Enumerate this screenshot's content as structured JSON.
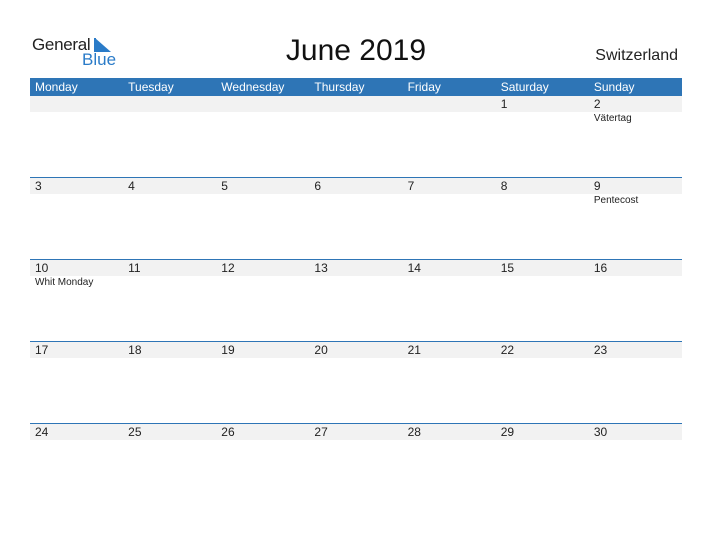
{
  "logo": {
    "general": "General",
    "blue": "Blue"
  },
  "header": {
    "title": "June 2019",
    "country": "Switzerland"
  },
  "weekdays": [
    "Monday",
    "Tuesday",
    "Wednesday",
    "Thursday",
    "Friday",
    "Saturday",
    "Sunday"
  ],
  "weeks": [
    {
      "days": [
        "",
        "",
        "",
        "",
        "",
        "1",
        "2"
      ],
      "holidays": [
        "",
        "",
        "",
        "",
        "",
        "",
        "Vätertag"
      ]
    },
    {
      "days": [
        "3",
        "4",
        "5",
        "6",
        "7",
        "8",
        "9"
      ],
      "holidays": [
        "",
        "",
        "",
        "",
        "",
        "",
        "Pentecost"
      ]
    },
    {
      "days": [
        "10",
        "11",
        "12",
        "13",
        "14",
        "15",
        "16"
      ],
      "holidays": [
        "Whit Monday",
        "",
        "",
        "",
        "",
        "",
        ""
      ]
    },
    {
      "days": [
        "17",
        "18",
        "19",
        "20",
        "21",
        "22",
        "23"
      ],
      "holidays": [
        "",
        "",
        "",
        "",
        "",
        "",
        ""
      ]
    },
    {
      "days": [
        "24",
        "25",
        "26",
        "27",
        "28",
        "29",
        "30"
      ],
      "holidays": [
        "",
        "",
        "",
        "",
        "",
        "",
        ""
      ]
    }
  ],
  "colors": {
    "accent": "#2e75b6",
    "strip": "#f2f2f2"
  }
}
